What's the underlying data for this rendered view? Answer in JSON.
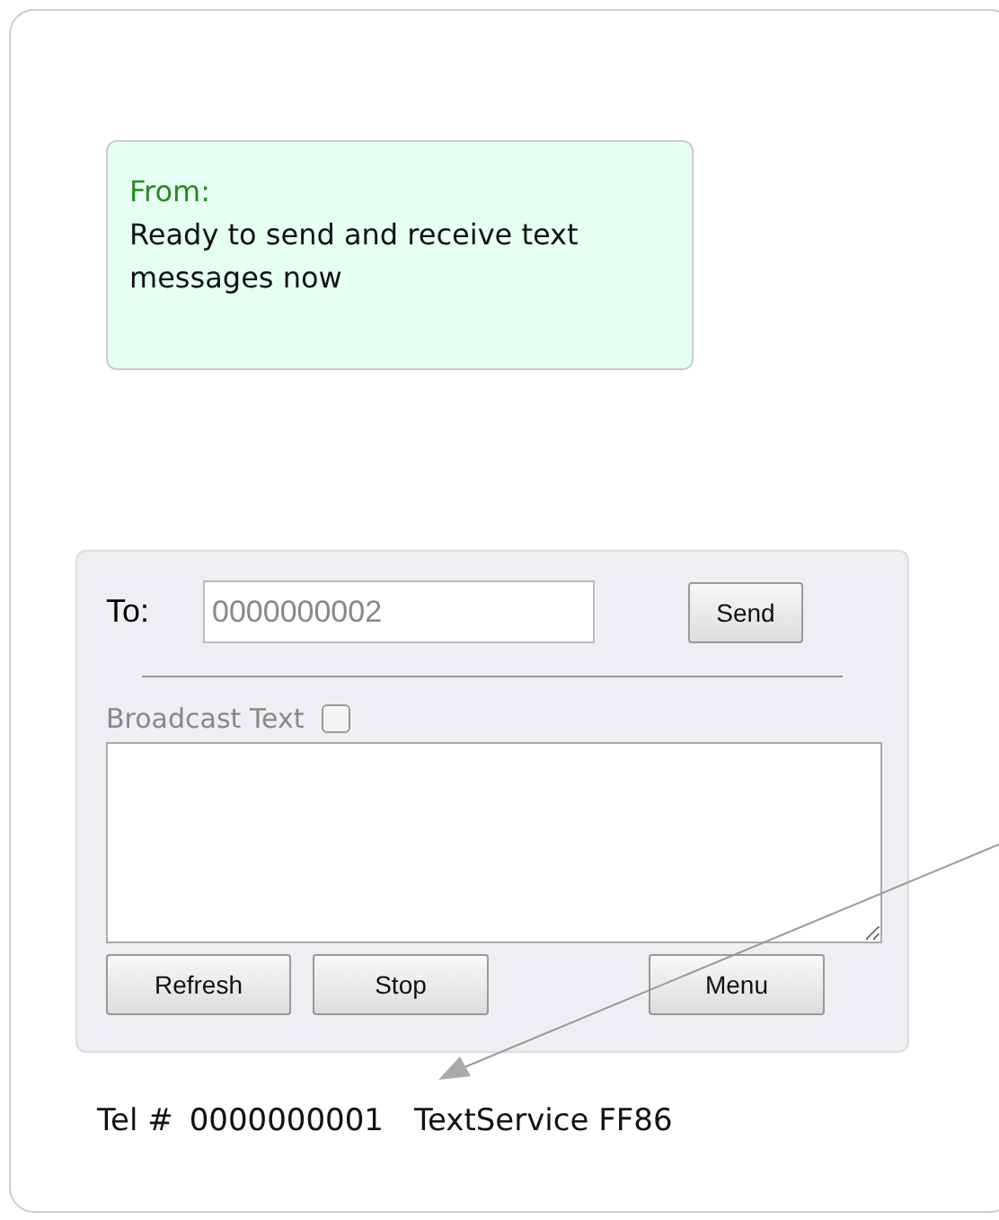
{
  "message": {
    "sender_label": "From:",
    "text": "Ready to send and receive text messages now"
  },
  "compose": {
    "to_label": "To:",
    "to_placeholder": "0000000002",
    "send_button": "Send",
    "broadcast_label": "Broadcast Text",
    "broadcast_checked": false,
    "buttons": [
      {
        "label": "Refresh"
      },
      {
        "label": "Stop"
      },
      {
        "label": "Menu"
      }
    ]
  },
  "footer": {
    "tel_label": "Tel #",
    "tel_number": "0000000001",
    "service": "TextService FF86"
  }
}
